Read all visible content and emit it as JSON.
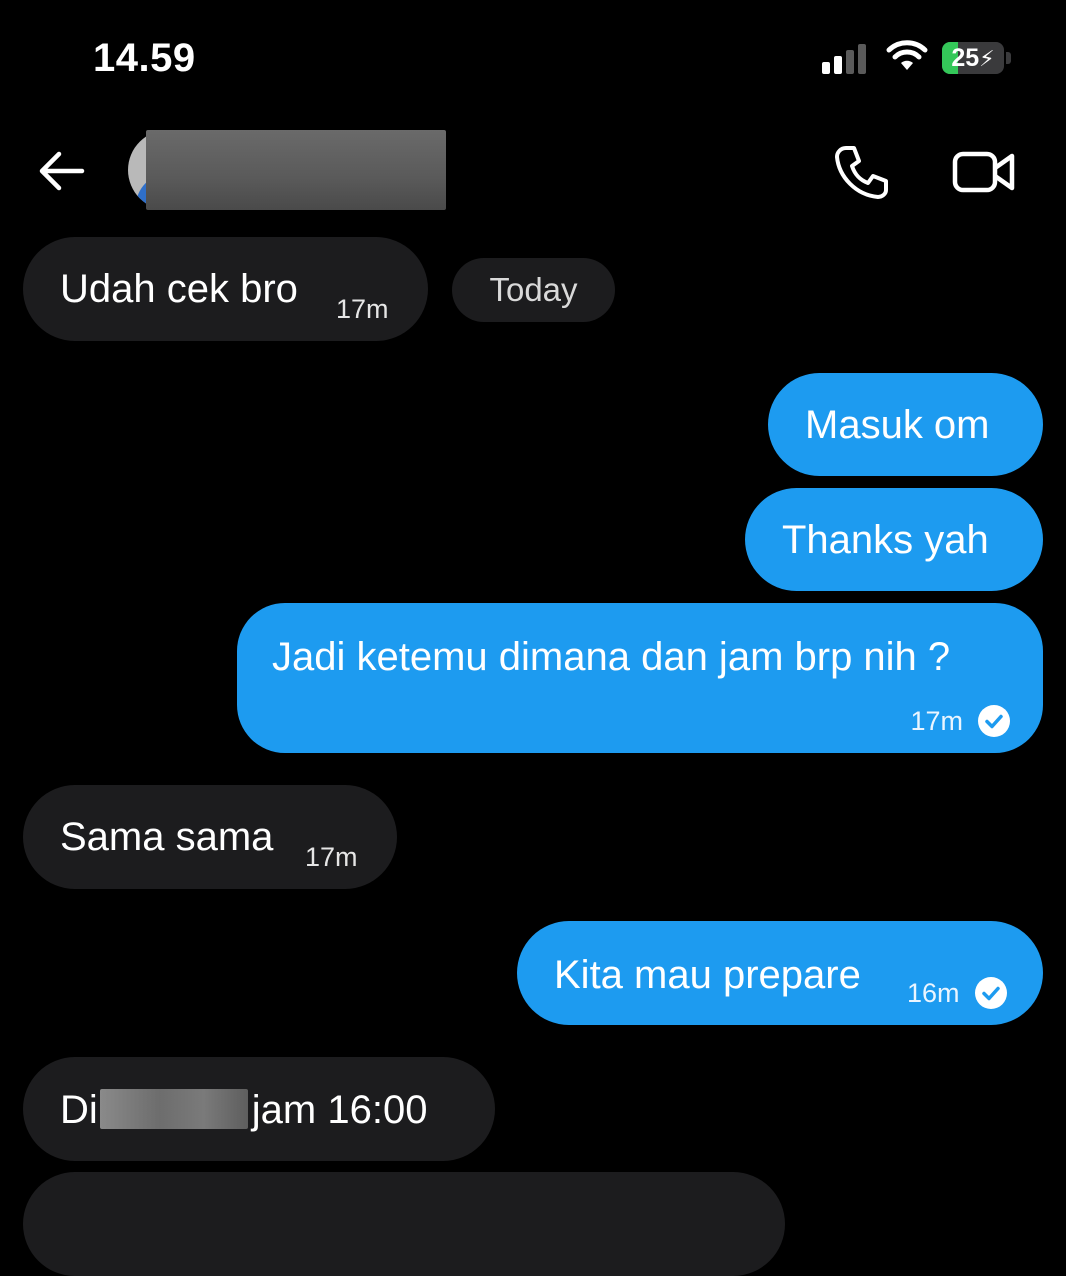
{
  "status_bar": {
    "time": "14.59",
    "battery_level": "25",
    "battery_fraction": 0.25,
    "charging_icon": "bolt-icon",
    "signal_bars_active": 2,
    "signal_bars_total": 4
  },
  "header": {
    "back_icon": "arrow-left-icon",
    "call_icon": "phone-icon",
    "video_icon": "video-camera-icon"
  },
  "messages": [
    {
      "direction": "incoming",
      "text": "Udah cek bro",
      "time": "17m"
    },
    {
      "direction": "outgoing",
      "text": "Masuk om"
    },
    {
      "direction": "outgoing",
      "text": "Thanks yah"
    },
    {
      "direction": "outgoing",
      "text": "Jadi ketemu dimana dan jam brp nih ?",
      "time": "17m",
      "status_icon": "check-circle-icon"
    },
    {
      "direction": "incoming",
      "text": "Sama sama",
      "time": "17m"
    },
    {
      "direction": "outgoing",
      "text": "Kita mau prepare",
      "time": "16m",
      "status_icon": "check-circle-icon"
    },
    {
      "direction": "incoming",
      "text_before": "Di",
      "text_after": "jam 16:00"
    },
    {
      "direction": "incoming",
      "text": ""
    }
  ],
  "date_separator": "Today",
  "colors": {
    "background": "#000000",
    "incoming_bubble": "#1c1c1e",
    "outgoing_bubble": "#1d9bf0",
    "battery_fill": "#34c759"
  }
}
